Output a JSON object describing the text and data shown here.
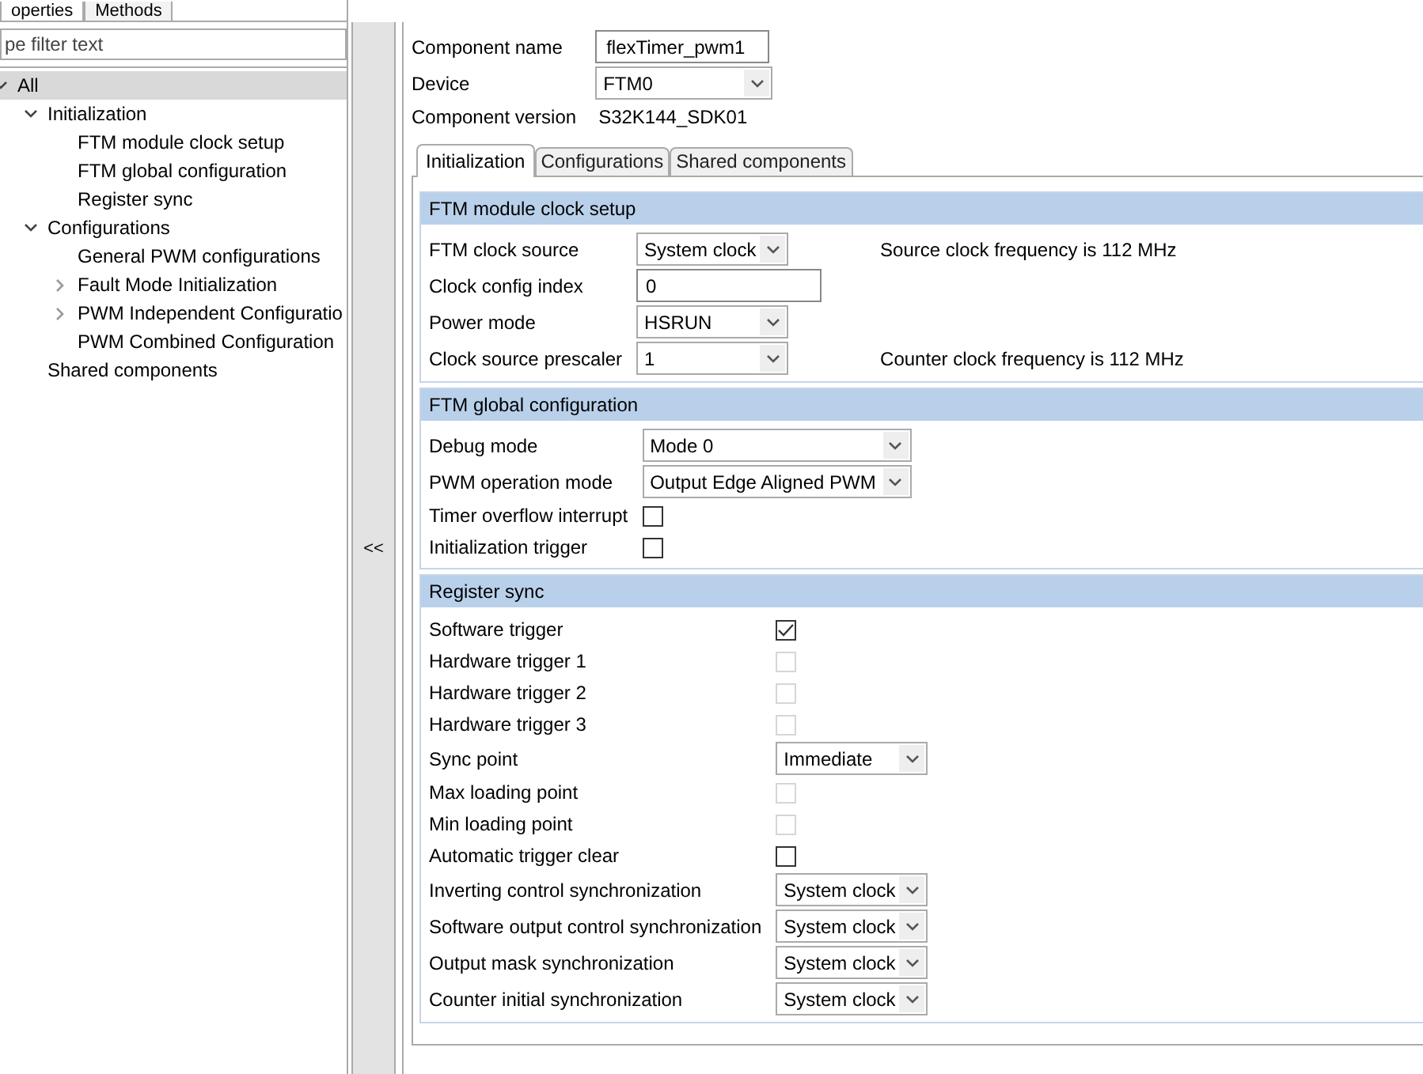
{
  "view_tabs": [
    {
      "label": "operties",
      "selected": true
    },
    {
      "label": "Methods",
      "selected": false
    }
  ],
  "filter": {
    "placeholder": "pe filter text"
  },
  "tree": [
    {
      "label": "All",
      "selected": true,
      "expanded": true,
      "children": [
        {
          "label": "Initialization",
          "selected": false,
          "expanded": true,
          "children": [
            {
              "label": "FTM module clock setup",
              "selected": false
            },
            {
              "label": "FTM global configuration",
              "selected": false
            },
            {
              "label": "Register sync",
              "selected": false
            }
          ]
        },
        {
          "label": "Configurations",
          "selected": false,
          "expanded": true,
          "children": [
            {
              "label": "General PWM configurations",
              "selected": false
            },
            {
              "label": "Fault Mode Initialization",
              "selected": false,
              "expanded": false
            },
            {
              "label": "PWM Independent Configuratio",
              "selected": false,
              "expanded": false
            },
            {
              "label": "PWM Combined Configuration",
              "selected": false
            }
          ]
        },
        {
          "label": "Shared components",
          "selected": false
        }
      ]
    }
  ],
  "collapse_button": "<<",
  "component_name": {
    "label": "Component name",
    "value": "flexTimer_pwm1"
  },
  "device": {
    "label": "Device",
    "value": "FTM0"
  },
  "component_version": {
    "label": "Component version",
    "value": "S32K144_SDK01"
  },
  "tabs": [
    {
      "label": "Initialization",
      "selected": true
    },
    {
      "label": "Configurations",
      "selected": false
    },
    {
      "label": "Shared components",
      "selected": false
    }
  ],
  "sections": [
    {
      "title": "FTM module clock setup",
      "fields": [
        {
          "label": "FTM clock source",
          "kind": "combo",
          "value": "System clock",
          "note": "Source clock frequency is 112 MHz"
        },
        {
          "label": "Clock config index",
          "kind": "text",
          "value": "0"
        },
        {
          "label": "Power mode",
          "kind": "combo",
          "value": "HSRUN"
        },
        {
          "label": "Clock source prescaler",
          "kind": "combo",
          "value": "1",
          "note": "Counter clock frequency is 112 MHz"
        }
      ]
    },
    {
      "title": "FTM global configuration",
      "fields": [
        {
          "label": "Debug mode",
          "kind": "combo",
          "value": "Mode 0"
        },
        {
          "label": "PWM operation mode",
          "kind": "combo",
          "value": "Output Edge Aligned PWM"
        },
        {
          "label": "Timer overflow interrupt",
          "kind": "check",
          "checked": false,
          "disabled": false
        },
        {
          "label": "Initialization trigger",
          "kind": "check",
          "checked": false,
          "disabled": false
        }
      ]
    },
    {
      "title": "Register sync",
      "fields": [
        {
          "label": "Software trigger",
          "kind": "check",
          "checked": true,
          "disabled": false
        },
        {
          "label": "Hardware trigger 1",
          "kind": "check",
          "checked": false,
          "disabled": true
        },
        {
          "label": "Hardware trigger 2",
          "kind": "check",
          "checked": false,
          "disabled": true
        },
        {
          "label": "Hardware trigger 3",
          "kind": "check",
          "checked": false,
          "disabled": true
        },
        {
          "label": "Sync point",
          "kind": "combo",
          "value": "Immediate"
        },
        {
          "label": "Max loading point",
          "kind": "check",
          "checked": false,
          "disabled": true
        },
        {
          "label": "Min loading point",
          "kind": "check",
          "checked": false,
          "disabled": true
        },
        {
          "label": "Automatic trigger clear",
          "kind": "check",
          "checked": false,
          "disabled": false
        },
        {
          "label": "Inverting control synchronization",
          "kind": "combo",
          "value": "System clock"
        },
        {
          "label": "Software output control synchronization",
          "kind": "combo",
          "value": "System clock"
        },
        {
          "label": "Output mask synchronization",
          "kind": "combo",
          "value": "System clock"
        },
        {
          "label": "Counter initial synchronization",
          "kind": "combo",
          "value": "System clock"
        }
      ]
    }
  ]
}
